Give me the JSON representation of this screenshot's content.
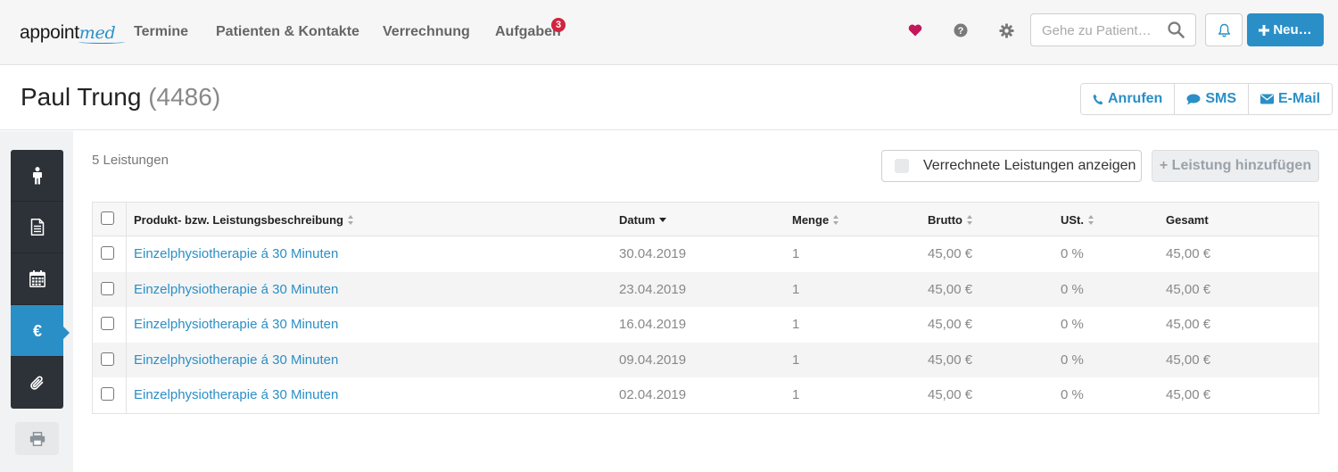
{
  "brand": {
    "part1": "appoint",
    "part2": "med"
  },
  "nav": [
    {
      "label": "Termine"
    },
    {
      "label": "Patienten & Kontakte"
    },
    {
      "label": "Verrechnung"
    },
    {
      "label": "Aufgaben",
      "badge": "3"
    }
  ],
  "search": {
    "placeholder": "Gehe zu Patient…",
    "icon": "search-icon"
  },
  "new_button": {
    "label": "Neu…",
    "icon": "plus-icon"
  },
  "icons": {
    "favorite": "heart-icon",
    "help": "question-circle-icon",
    "settings": "gear-icon",
    "notifications": "bell-icon"
  },
  "colors": {
    "accent": "#2a8fc7",
    "badge": "#d0243f",
    "heart": "#c2185b",
    "sidebar_dark": "#2d3238"
  },
  "patient": {
    "name": "Paul Trung",
    "id": "(4486)"
  },
  "contact": [
    {
      "label": "Anrufen",
      "icon": "phone-icon"
    },
    {
      "label": "SMS",
      "icon": "comment-icon"
    },
    {
      "label": "E-Mail",
      "icon": "envelope-icon"
    }
  ],
  "sidebar": {
    "items": [
      {
        "icon": "person-icon"
      },
      {
        "icon": "document-icon"
      },
      {
        "icon": "calendar-icon"
      },
      {
        "icon": "euro-icon",
        "active": true
      },
      {
        "icon": "paperclip-icon"
      }
    ],
    "print_icon": "printer-icon"
  },
  "services": {
    "count_label": "5 Leistungen",
    "toggle_label": "Verrechnete Leistungen anzeigen",
    "add_label": "+ Leistung hinzufügen",
    "columns": [
      "Produkt- bzw. Leistungsbeschreibung",
      "Datum",
      "Menge",
      "Brutto",
      "USt.",
      "Gesamt"
    ],
    "rows": [
      [
        "Einzelphysiotherapie á 30 Minuten",
        "30.04.2019",
        "1",
        "45,00 €",
        "0 %",
        "45,00 €"
      ],
      [
        "Einzelphysiotherapie á 30 Minuten",
        "23.04.2019",
        "1",
        "45,00 €",
        "0 %",
        "45,00 €"
      ],
      [
        "Einzelphysiotherapie á 30 Minuten",
        "16.04.2019",
        "1",
        "45,00 €",
        "0 %",
        "45,00 €"
      ],
      [
        "Einzelphysiotherapie á 30 Minuten",
        "09.04.2019",
        "1",
        "45,00 €",
        "0 %",
        "45,00 €"
      ],
      [
        "Einzelphysiotherapie á 30 Minuten",
        "02.04.2019",
        "1",
        "45,00 €",
        "0 %",
        "45,00 €"
      ]
    ]
  }
}
